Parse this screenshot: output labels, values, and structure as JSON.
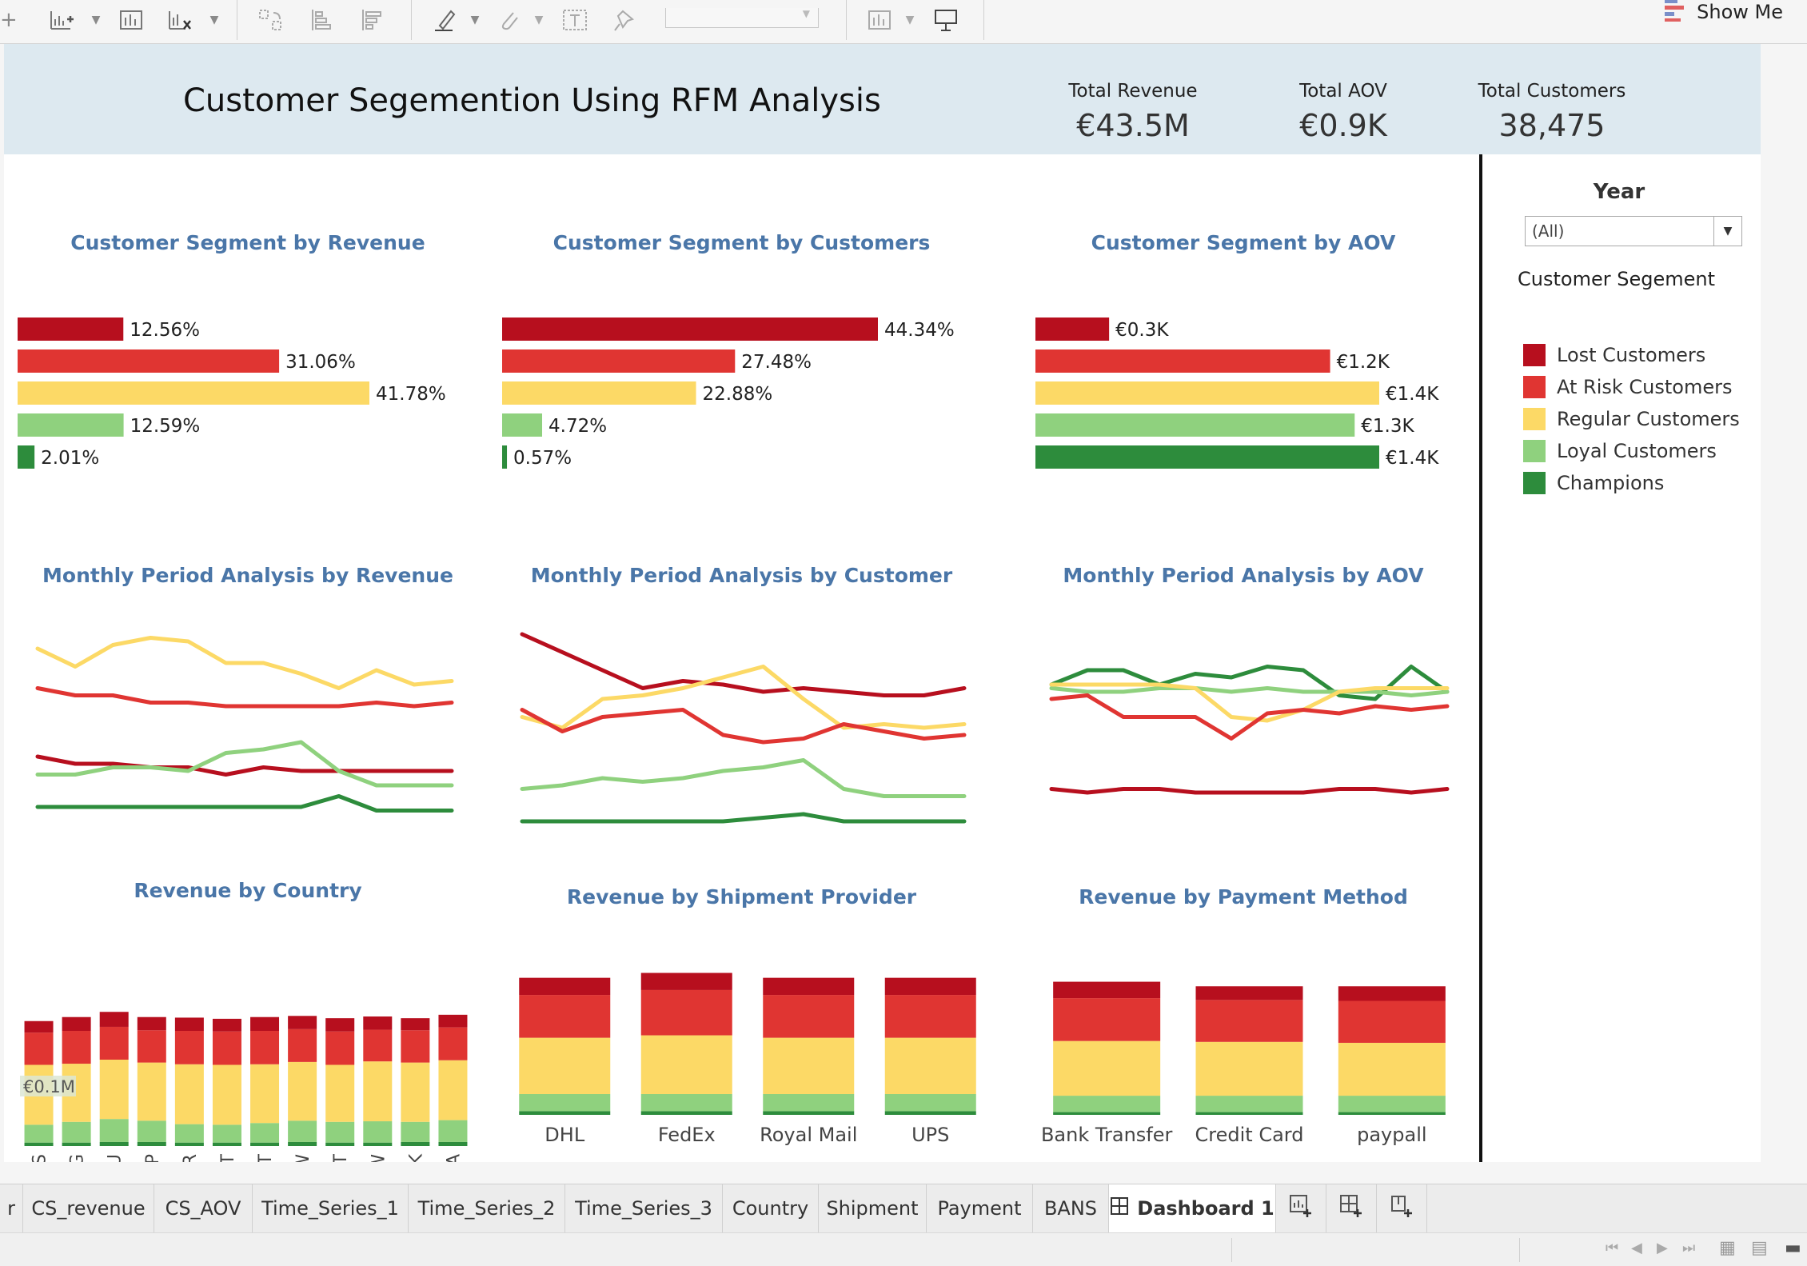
{
  "toolbar": {
    "icons": [
      "add-chart-icon",
      "chart-icon",
      "clear-chart-icon",
      "swap-icon",
      "sort-ascending-icon",
      "sort-descending-icon",
      "highlight-icon",
      "attach-icon",
      "text-label-icon",
      "pin-icon",
      "chart-type-icon",
      "presentation-icon"
    ],
    "show_me_label": "Show Me"
  },
  "header": {
    "title": "Customer Segemention Using RFM Analysis",
    "kpis": [
      {
        "label": "Total Revenue",
        "value": "€43.5M"
      },
      {
        "label": "Total AOV",
        "value": "€0.9K"
      },
      {
        "label": "Total Customers",
        "value": "38,475"
      }
    ]
  },
  "segments": [
    {
      "name": "Lost Customers",
      "color": "#b70f1e"
    },
    {
      "name": "At Risk Customers",
      "color": "#e03532"
    },
    {
      "name": "Regular Customers",
      "color": "#fcd966"
    },
    {
      "name": "Loyal Customers",
      "color": "#8fd17e"
    },
    {
      "name": "Champions",
      "color": "#2d8c3c"
    }
  ],
  "filter": {
    "title": "Year",
    "selected": "(All)"
  },
  "legend": {
    "title": "Customer Segement"
  },
  "charts": {
    "seg_revenue": {
      "title": "Customer Segment by Revenue"
    },
    "seg_customers": {
      "title": "Customer Segment by Customers"
    },
    "seg_aov": {
      "title": "Customer Segment by AOV"
    },
    "ts_revenue": {
      "title": "Monthly Period Analysis by Revenue"
    },
    "ts_customers": {
      "title": "Monthly Period Analysis by Customer"
    },
    "ts_aov": {
      "title": "Monthly Period Analysis by AOV"
    },
    "country": {
      "title": "Revenue by Country",
      "tooltip": "€0.1M"
    },
    "shipment": {
      "title": "Revenue by Shipment Provider"
    },
    "payment": {
      "title": "Revenue by Payment Method"
    }
  },
  "chart_data": [
    {
      "type": "bar",
      "orientation": "horizontal",
      "title": "Customer Segment by Revenue",
      "categories": [
        "Lost Customers",
        "At Risk Customers",
        "Regular Customers",
        "Loyal Customers",
        "Champions"
      ],
      "values": [
        12.56,
        31.06,
        41.78,
        12.59,
        2.01
      ],
      "labels": [
        "12.56%",
        "31.06%",
        "41.78%",
        "12.59%",
        "2.01%"
      ]
    },
    {
      "type": "bar",
      "orientation": "horizontal",
      "title": "Customer Segment by Customers",
      "categories": [
        "Lost Customers",
        "At Risk Customers",
        "Regular Customers",
        "Loyal Customers",
        "Champions"
      ],
      "values": [
        44.34,
        27.48,
        22.88,
        4.72,
        0.57
      ],
      "labels": [
        "44.34%",
        "27.48%",
        "22.88%",
        "4.72%",
        "0.57%"
      ]
    },
    {
      "type": "bar",
      "orientation": "horizontal",
      "title": "Customer Segment by AOV",
      "categories": [
        "Lost Customers",
        "At Risk Customers",
        "Regular Customers",
        "Loyal Customers",
        "Champions"
      ],
      "values": [
        0.3,
        1.2,
        1.4,
        1.3,
        1.4
      ],
      "labels": [
        "€0.3K",
        "€1.2K",
        "€1.4K",
        "€1.3K",
        "€1.4K"
      ]
    },
    {
      "type": "line",
      "title": "Monthly Period Analysis by Revenue",
      "series": [
        {
          "name": "Regular Customers",
          "values": [
            52,
            47,
            53,
            55,
            54,
            48,
            48,
            45,
            41,
            46,
            42,
            43
          ]
        },
        {
          "name": "At Risk Customers",
          "values": [
            41,
            39,
            39,
            37,
            37,
            36,
            36,
            36,
            36,
            37,
            36,
            37
          ]
        },
        {
          "name": "Lost Customers",
          "values": [
            22,
            20,
            20,
            19,
            19,
            17,
            19,
            18,
            18,
            18,
            18,
            18
          ]
        },
        {
          "name": "Loyal Customers",
          "values": [
            17,
            17,
            19,
            19,
            18,
            23,
            24,
            26,
            18,
            14,
            14,
            14
          ]
        },
        {
          "name": "Champions",
          "values": [
            8,
            8,
            8,
            8,
            8,
            8,
            8,
            8,
            11,
            7,
            7,
            7
          ]
        }
      ]
    },
    {
      "type": "line",
      "title": "Monthly Period Analysis by Customer",
      "series": [
        {
          "name": "Lost Customers",
          "values": [
            56,
            51,
            46,
            41,
            43,
            42,
            40,
            41,
            40,
            39,
            39,
            41
          ]
        },
        {
          "name": "Regular Customers",
          "values": [
            33,
            30,
            38,
            39,
            41,
            44,
            47,
            38,
            30,
            31,
            30,
            31
          ]
        },
        {
          "name": "At Risk Customers",
          "values": [
            35,
            29,
            33,
            34,
            35,
            28,
            26,
            27,
            31,
            29,
            27,
            28
          ]
        },
        {
          "name": "Loyal Customers",
          "values": [
            13,
            14,
            16,
            15,
            16,
            18,
            19,
            21,
            13,
            11,
            11,
            11
          ]
        },
        {
          "name": "Champions",
          "values": [
            4,
            4,
            4,
            4,
            4,
            4,
            5,
            6,
            4,
            4,
            4,
            4
          ]
        }
      ]
    },
    {
      "type": "line",
      "title": "Monthly Period Analysis by AOV",
      "series": [
        {
          "name": "Champions",
          "values": [
            42,
            46,
            46,
            42,
            45,
            44,
            47,
            46,
            39,
            38,
            47,
            40
          ]
        },
        {
          "name": "Loyal Customers",
          "values": [
            41,
            40,
            40,
            41,
            41,
            40,
            41,
            40,
            40,
            40,
            39,
            40
          ]
        },
        {
          "name": "Regular Customers",
          "values": [
            42,
            42,
            42,
            42,
            41,
            33,
            32,
            35,
            40,
            41,
            41,
            41
          ]
        },
        {
          "name": "At Risk Customers",
          "values": [
            38,
            39,
            33,
            33,
            33,
            27,
            34,
            35,
            34,
            36,
            35,
            36
          ]
        },
        {
          "name": "Lost Customers",
          "values": [
            13,
            12,
            13,
            13,
            12,
            12,
            12,
            12,
            13,
            13,
            12,
            13
          ]
        }
      ]
    },
    {
      "type": "bar",
      "stacked": true,
      "title": "Revenue by Country",
      "categories": [
        "AUS",
        "BG",
        "DU",
        "ESP",
        "FR",
        "IT",
        "NET",
        "NW",
        "PT",
        "SW",
        "UK",
        "USA"
      ],
      "series": [
        {
          "name": "Champions",
          "values": [
            0.6,
            0.6,
            0.7,
            0.7,
            0.6,
            0.6,
            0.6,
            0.7,
            0.6,
            0.6,
            0.7,
            0.7
          ]
        },
        {
          "name": "Loyal Customers",
          "values": [
            3.1,
            3.6,
            4.0,
            3.7,
            3.2,
            3.1,
            3.4,
            3.7,
            3.6,
            3.7,
            3.5,
            3.8
          ]
        },
        {
          "name": "Regular Customers",
          "values": [
            10.4,
            10.1,
            10.3,
            10.1,
            10.4,
            10.4,
            10.2,
            10.2,
            9.9,
            10.4,
            10.3,
            10.4
          ]
        },
        {
          "name": "At Risk Customers",
          "values": [
            5.6,
            5.7,
            5.7,
            5.6,
            5.8,
            5.8,
            5.8,
            5.7,
            5.8,
            5.5,
            5.6,
            5.7
          ]
        },
        {
          "name": "Lost Customers",
          "values": [
            2.0,
            2.4,
            2.6,
            2.3,
            2.3,
            2.2,
            2.4,
            2.3,
            2.3,
            2.3,
            2.1,
            2.2
          ]
        }
      ]
    },
    {
      "type": "bar",
      "stacked": true,
      "title": "Revenue by Shipment Provider",
      "categories": [
        "DHL",
        "FedEx",
        "Royal Mail",
        "UPS"
      ],
      "series": [
        {
          "name": "Champions",
          "values": [
            0.3,
            0.3,
            0.3,
            0.3
          ]
        },
        {
          "name": "Loyal Customers",
          "values": [
            1.4,
            1.4,
            1.4,
            1.4
          ]
        },
        {
          "name": "Regular Customers",
          "values": [
            4.6,
            4.8,
            4.6,
            4.6
          ]
        },
        {
          "name": "At Risk Customers",
          "values": [
            3.5,
            3.7,
            3.5,
            3.5
          ]
        },
        {
          "name": "Lost Customers",
          "values": [
            1.4,
            1.4,
            1.4,
            1.4
          ]
        }
      ]
    },
    {
      "type": "bar",
      "stacked": true,
      "title": "Revenue by Payment Method",
      "categories": [
        "Bank Transfer",
        "Credit Card",
        "paypall"
      ],
      "series": [
        {
          "name": "Champions",
          "values": [
            0.3,
            0.3,
            0.3
          ]
        },
        {
          "name": "Loyal Customers",
          "values": [
            1.8,
            1.8,
            1.8
          ]
        },
        {
          "name": "Regular Customers",
          "values": [
            6.0,
            5.9,
            5.8
          ]
        },
        {
          "name": "At Risk Customers",
          "values": [
            4.7,
            4.6,
            4.6
          ]
        },
        {
          "name": "Lost Customers",
          "values": [
            1.8,
            1.5,
            1.6
          ]
        }
      ]
    }
  ],
  "tabs": [
    {
      "label": "r"
    },
    {
      "label": "CS_revenue"
    },
    {
      "label": "CS_AOV"
    },
    {
      "label": "Time_Series_1"
    },
    {
      "label": "Time_Series_2"
    },
    {
      "label": "Time_Series_3"
    },
    {
      "label": "Country"
    },
    {
      "label": "Shipment"
    },
    {
      "label": "Payment"
    },
    {
      "label": "BANS"
    },
    {
      "label": "Dashboard 1"
    }
  ]
}
